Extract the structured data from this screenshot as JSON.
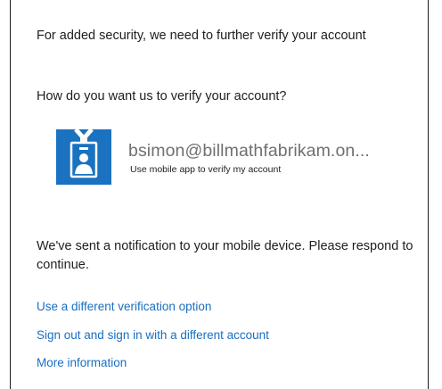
{
  "intro_text": "For added security, we need to further verify your account",
  "question_text": "How do you want us to verify your account?",
  "account": {
    "email": "bsimon@billmathfabrikam.on...",
    "method_label": "Use mobile app to verify my account",
    "icon": "id-badge-icon",
    "icon_color": "#1a72c0"
  },
  "notification_text": "We've sent a notification to your mobile device. Please respond to continue.",
  "links": {
    "different_option": "Use a different verification option",
    "sign_out": "Sign out and sign in with a different account",
    "more_info": "More information"
  },
  "colors": {
    "link": "#1a6fc2",
    "email_text": "#707070",
    "text": "#1e1e1e"
  }
}
